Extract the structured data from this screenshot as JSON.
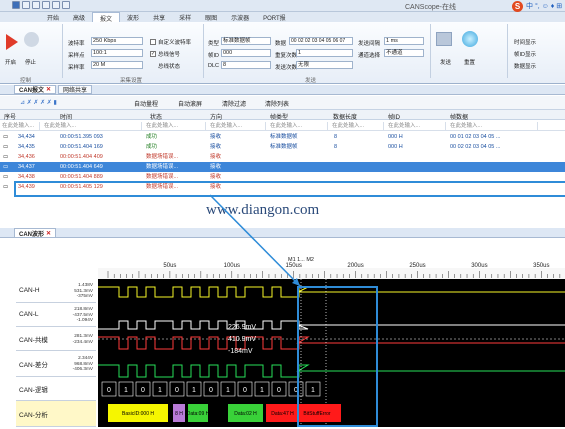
{
  "window": {
    "title": "CANScope-在线",
    "brand_text": "中 °, ☺ ♦ ⊞"
  },
  "menu_tabs": [
    "开始",
    "高级",
    "报文",
    "波形",
    "共享",
    "采样",
    "眼图",
    "示波器",
    "PORT报"
  ],
  "ribbon": {
    "start_label": "开启",
    "stop_label": "停止",
    "baudrate_label": "波特率",
    "baudrate_value": "250 Kbps",
    "sample_point_label": "采样点",
    "sample_point_value": "100:1",
    "sample_rate_label": "采样率",
    "sample_rate_value": "20 M",
    "auto_recog_label": "自定义波特率",
    "terminal_label": "总线信号",
    "state_label": "总线状态",
    "type_label": "类型",
    "type_value": "标准数据帧",
    "frame_id_label": "帧ID",
    "frame_id_value": "000",
    "dlc_label": "DLC",
    "dlc_value": "8",
    "data_label": "数据",
    "data_value": "00 02 02 03 04 05 06 07",
    "repeat_label": "重复次数",
    "repeat_value": "1",
    "send_count_label": "发送次数",
    "send_count_value": "无限",
    "interval_label": "发送间隔",
    "interval_value": "1 ms",
    "mode_label": "通道选择",
    "mode_value": "不通道",
    "send_label": "发送",
    "reset_label": "重置",
    "right_items": [
      "时间显示",
      "帧ID显示",
      "数据显示"
    ],
    "groups": [
      "控制",
      "采集设置",
      "发送"
    ]
  },
  "panel_tabs": [
    "CAN报文",
    "网络共享"
  ],
  "toolbar": [
    "自动量程",
    "自动滚屏",
    "清除过滤",
    "清除列表"
  ],
  "table": {
    "headers": [
      "序号",
      "时间",
      "状态",
      "方向",
      "帧类型",
      "数据长度",
      "帧ID",
      "帧数据"
    ],
    "filter_placeholder": "在此处输入...",
    "rows": [
      {
        "idx": "34,434",
        "time": "00:00:51.395 093",
        "state": "成功",
        "dir": "接收",
        "type": "标准数据帧",
        "len": "8",
        "id": "000 H",
        "data": "00 01 02 03 04 05 ..."
      },
      {
        "idx": "34,435",
        "time": "00:00:51.404 169",
        "state": "成功",
        "dir": "接收",
        "type": "标准数据帧",
        "len": "8",
        "id": "000 H",
        "data": "00 02 02 03 04 05 ..."
      },
      {
        "idx": "34,436",
        "time": "00:00:51.404 409",
        "state": "数据场错误...",
        "dir": "接收",
        "type": "",
        "len": "",
        "id": "",
        "data": ""
      },
      {
        "idx": "34,437",
        "time": "00:00:51.404 649",
        "state": "数据场错误...",
        "dir": "接收",
        "type": "",
        "len": "",
        "id": "",
        "data": ""
      },
      {
        "idx": "34,438",
        "time": "00:00:51.404 889",
        "state": "数据场错误...",
        "dir": "接收",
        "type": "",
        "len": "",
        "id": "",
        "data": ""
      },
      {
        "idx": "34,439",
        "time": "00:00:51.405 129",
        "state": "数据场错误...",
        "dir": "接收",
        "type": "",
        "len": "",
        "id": "",
        "data": ""
      }
    ]
  },
  "watermark": "www.diangon.com",
  "wave": {
    "title": "CAN波形",
    "marker_label": "M1 1... M2",
    "ticks": [
      "50us",
      "100us",
      "150us",
      "200us",
      "250us",
      "300us",
      "350us"
    ],
    "channels": [
      {
        "name": "CAN-H",
        "values": [
          "1.438V",
          "531.3mV",
          "-375mV"
        ]
      },
      {
        "name": "CAN-L",
        "values": [
          "218.8mV",
          "-437.5mV",
          "-1.094V"
        ]
      },
      {
        "name": "CAN-共模",
        "values": [
          "281.3mV",
          "-234.4mV"
        ]
      },
      {
        "name": "CAN-差分",
        "values": [
          "2.344V",
          "968.8mV",
          "-406.3mV"
        ]
      },
      {
        "name": "CAN-逻辑",
        "values": []
      },
      {
        "name": "CAN-分析",
        "values": []
      }
    ],
    "readouts": [
      "226.9mV",
      "410.9mV",
      "-184mV"
    ],
    "logic_bits": [
      "0",
      "1",
      "0",
      "1",
      "0",
      "1",
      "0",
      "1",
      "0",
      "1",
      "0",
      "0",
      "1"
    ],
    "decode": [
      {
        "text": "BasicID:000 H",
        "color": "#f6f600"
      },
      {
        "text": "8 H",
        "color": "#b97bd8"
      },
      {
        "text": "Data:09 H",
        "color": "#39d139"
      },
      {
        "text": "Data:02 H",
        "color": "#39d139"
      },
      {
        "text": "Data:47 H",
        "color": "#ff1a1a"
      },
      {
        "text": "BitStuffError",
        "color": "#ff1a1a"
      }
    ],
    "colors": {
      "canh": "#f7f728",
      "canl": "#ffffff",
      "common": "#ff3b3b",
      "diff": "#27e05a",
      "highlight": "#2f8cd8"
    }
  }
}
